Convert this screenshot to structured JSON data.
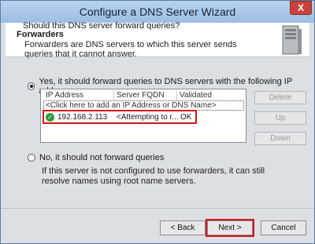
{
  "window": {
    "title": "Configure a DNS Server Wizard",
    "close_label": "X"
  },
  "header": {
    "title": "Forwarders",
    "description": "Forwarders are DNS servers to which this server sends queries that it cannot answer."
  },
  "question": "Should this DNS server forward queries?",
  "options": {
    "yes_label": "Yes, it should forward queries to DNS servers with the following IP addresses:",
    "no_label": "No, it should not forward queries",
    "selected": "yes"
  },
  "list": {
    "columns": [
      "IP Address",
      "Server FQDN",
      "Validated"
    ],
    "add_row": "<Click here to add an IP Address or DNS Name>",
    "entries": [
      {
        "ip": "192.168.2.113",
        "fqdn": "<Attempting to r...",
        "validated": "OK"
      }
    ]
  },
  "side_buttons": {
    "delete": "Delete",
    "up": "Up",
    "down": "Down"
  },
  "info_text": "If this server is not configured to use forwarders, it can still resolve names using root name servers.",
  "footer": {
    "back": "< Back",
    "next": "Next >",
    "cancel": "Cancel"
  },
  "colors": {
    "highlight": "#d4131a"
  }
}
